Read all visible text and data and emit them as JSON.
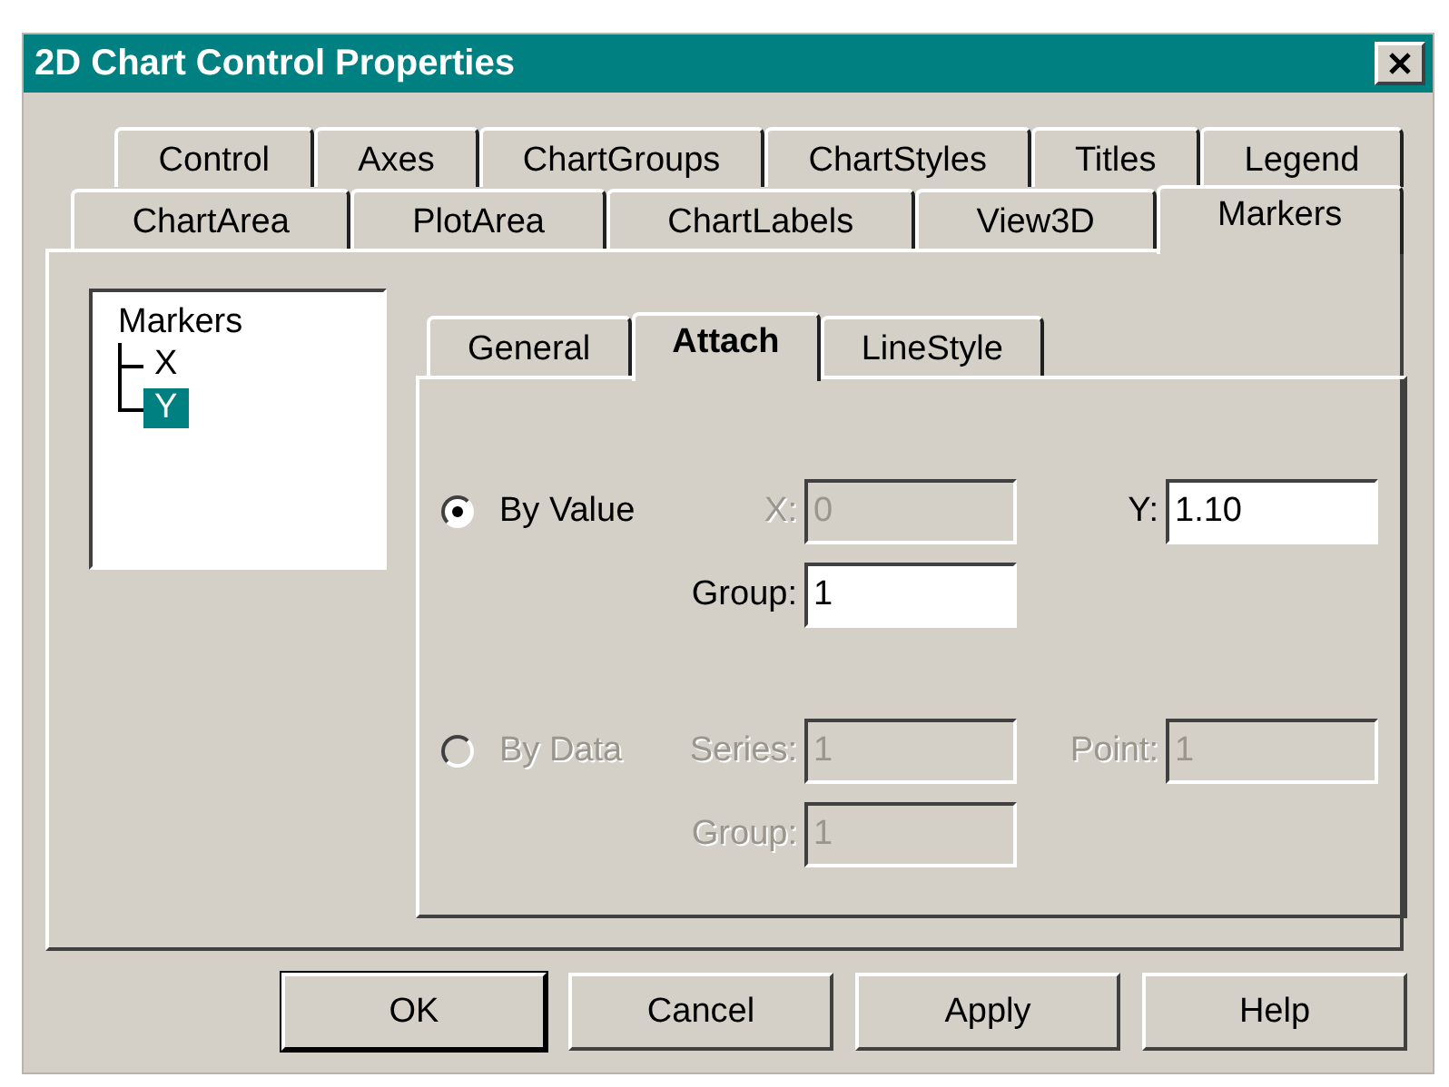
{
  "window": {
    "title": "2D Chart Control Properties"
  },
  "tab_rows": [
    [
      {
        "label": "Control",
        "selected": false
      },
      {
        "label": "Axes",
        "selected": false
      },
      {
        "label": "ChartGroups",
        "selected": false
      },
      {
        "label": "ChartStyles",
        "selected": false
      },
      {
        "label": "Titles",
        "selected": false
      },
      {
        "label": "Legend",
        "selected": false
      }
    ],
    [
      {
        "label": "ChartArea",
        "selected": false
      },
      {
        "label": "PlotArea",
        "selected": false
      },
      {
        "label": "ChartLabels",
        "selected": false
      },
      {
        "label": "View3D",
        "selected": false
      },
      {
        "label": "Markers",
        "selected": true
      }
    ]
  ],
  "tree": {
    "label": "Markers",
    "children": [
      {
        "label": "X",
        "selected": false
      },
      {
        "label": "Y",
        "selected": true
      }
    ]
  },
  "subtabs": [
    {
      "label": "General",
      "selected": false
    },
    {
      "label": "Attach",
      "selected": true
    },
    {
      "label": "LineStyle",
      "selected": false
    }
  ],
  "options": [
    {
      "label": "By Value",
      "selected": true,
      "disabled": false,
      "fields": [
        {
          "label": "X:",
          "value": "0",
          "disabled": true
        },
        {
          "label": "Y:",
          "value": "1.10",
          "disabled": false
        },
        {
          "label": "Group:",
          "value": "1",
          "disabled": false
        }
      ]
    },
    {
      "label": "By Data",
      "selected": false,
      "disabled": true,
      "fields": [
        {
          "label": "Series:",
          "value": "1",
          "disabled": true
        },
        {
          "label": "Point:",
          "value": "1",
          "disabled": true
        },
        {
          "label": "Group:",
          "value": "1",
          "disabled": true
        }
      ]
    }
  ],
  "buttons": [
    {
      "label": "OK",
      "default": true
    },
    {
      "label": "Cancel",
      "default": false
    },
    {
      "label": "Apply",
      "default": false
    },
    {
      "label": "Help",
      "default": false
    }
  ]
}
